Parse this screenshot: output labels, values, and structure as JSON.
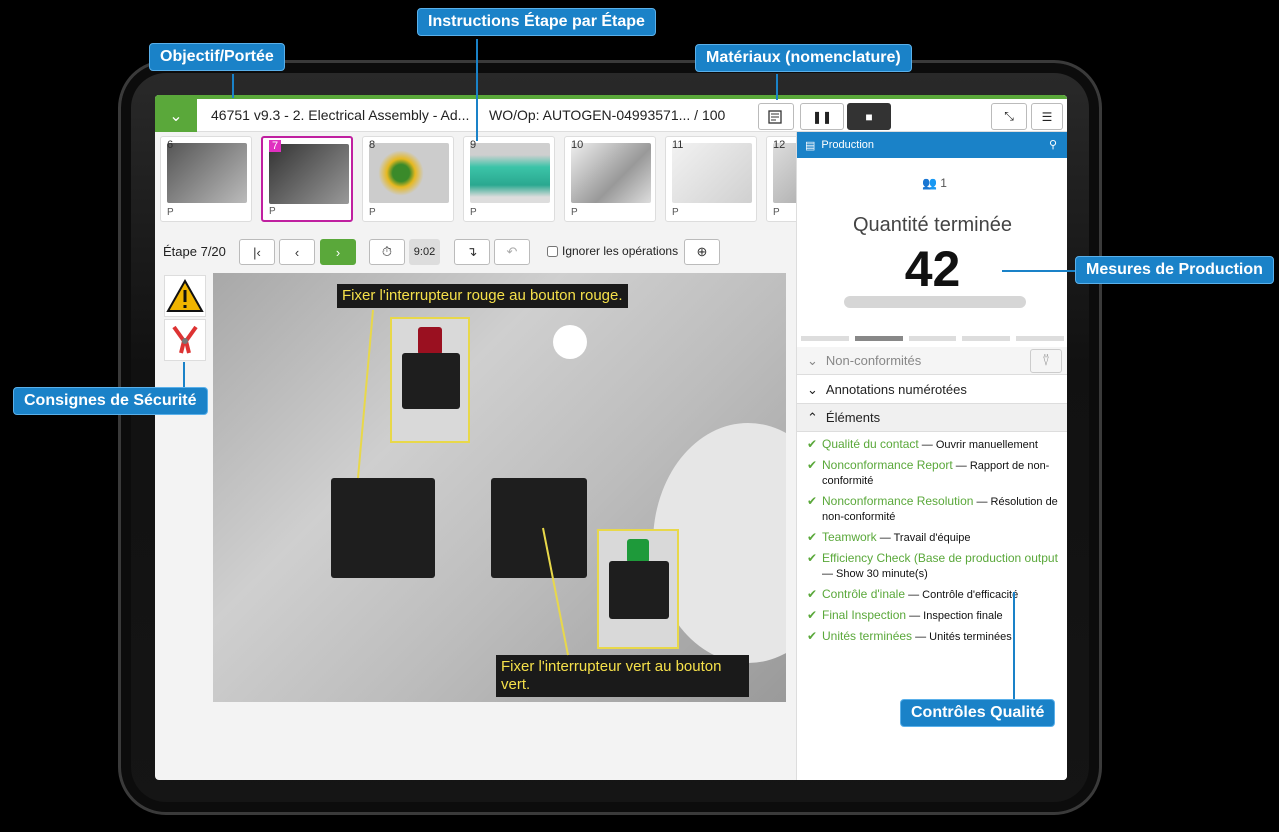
{
  "callouts": {
    "scope": "Objectif/Portée",
    "instructions": "Instructions Étape par Étape",
    "materials": "Matériaux (nomenclature)",
    "production": "Mesures de Production",
    "safety": "Consignes de Sécurité",
    "quality": "Contrôles Qualité"
  },
  "header": {
    "title": "46751 v9.3 - 2. Electrical Assembly - Ad...",
    "work_order": "WO/Op:  AUTOGEN-04993571...   / 100",
    "expand_icon": "chevron-down-icon"
  },
  "thumbnails": [
    {
      "num": "6",
      "label": "P"
    },
    {
      "num": "7",
      "label": "P"
    },
    {
      "num": "8",
      "label": "P"
    },
    {
      "num": "9",
      "label": "P"
    },
    {
      "num": "10",
      "label": "P"
    },
    {
      "num": "11",
      "label": "P"
    },
    {
      "num": "12",
      "label": "P"
    }
  ],
  "step_nav": {
    "step_label": "Étape 7/20",
    "timer": "9:02",
    "ignore_label": "Ignorer les opérations"
  },
  "photo": {
    "caption_top": "Fixer l'interrupteur rouge au bouton rouge.",
    "caption_bottom": "Fixer l'interrupteur vert au bouton vert."
  },
  "panel": {
    "header": "Production",
    "users": "1",
    "quantity_label": "Quantité terminée",
    "quantity_value": "42",
    "nonconformities": "Non-conformités",
    "annotations": "Annotations numérotées",
    "elements": "Éléments",
    "items": [
      {
        "name": "Qualité du contact",
        "desc": " — Ouvrir manuellement"
      },
      {
        "name": "Nonconformance Report",
        "desc": " — Rapport de non-conformité"
      },
      {
        "name": "Nonconformance Resolution",
        "desc": " — Résolution de non-conformité"
      },
      {
        "name": "Teamwork",
        "desc": " — Travail d'équipe"
      },
      {
        "name": "Efficiency Check (Base de production output",
        "desc": " — Show 30 minute(s)"
      },
      {
        "name": "Contrôle d'inale",
        "desc": " — Contrôle d'efficacité"
      },
      {
        "name": "Final Inspection",
        "desc": " — Inspection finale"
      },
      {
        "name": "Unités terminées",
        "desc": " — Unités terminées"
      }
    ]
  },
  "colors": {
    "accent": "#5aa83a",
    "callout": "#1a82c8",
    "active_thumb": "#e030c0"
  }
}
